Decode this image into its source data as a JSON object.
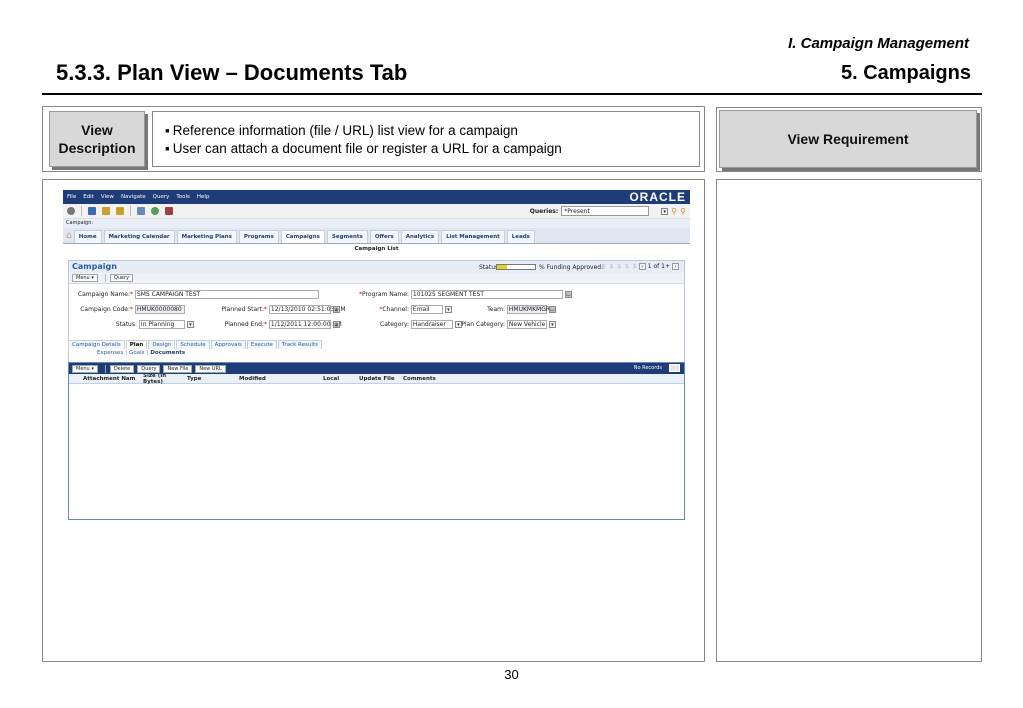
{
  "header": {
    "section": "I. Campaign Management",
    "title": "5.3.3. Plan View – Documents Tab",
    "chapter": "5. Campaigns"
  },
  "description": {
    "label_line1": "View",
    "label_line2": "Description",
    "bullets": [
      "Reference information (file / URL) list view for a campaign",
      "User can attach a document file or register a URL for a campaign"
    ]
  },
  "requirement": {
    "label": "View Requirement"
  },
  "page_number": "30",
  "app": {
    "menu": [
      "File",
      "Edit",
      "View",
      "Navigate",
      "Query",
      "Tools",
      "Help"
    ],
    "logo": "ORACLE",
    "queries_label": "Queries:",
    "queries_value": "*Present",
    "campaign_label": "Campaign:",
    "tabs": [
      "Home",
      "Marketing Calendar",
      "Marketing Plans",
      "Programs",
      "Campaigns",
      "Segments",
      "Offers",
      "Analytics",
      "List Management",
      "Leads"
    ],
    "active_tab": "Campaigns",
    "subtitle": "Campaign List",
    "applet": {
      "title": "Campaign",
      "status_label": "Status:",
      "status_progress": 0.25,
      "funding_label": "% Funding Approved:",
      "funding_dots": "$ $ $ $ $",
      "record_nav": "1 of 1+",
      "menu_btn": "Menu ▾",
      "query_btn": "Query"
    },
    "fields": {
      "campaign_name_label": "Campaign Name:",
      "campaign_name": "SMS CAMPAIGN TEST",
      "program_name_label": "Program Name:",
      "program_name": "101025 SEGMENT TEST",
      "campaign_code_label": "Campaign Code:",
      "campaign_code": "HMUK0000080",
      "planned_start_label": "Planned Start:",
      "planned_start": "12/13/2010 02:51:03 AM",
      "channel_label": "Channel:",
      "channel": "Email",
      "team_label": "Team:",
      "team": "HMUKMKMGR1",
      "status_label": "Status:",
      "status": "In Planning",
      "planned_end_label": "Planned End:",
      "planned_end": "1/12/2011 12:00:00 AM",
      "category_label": "Category:",
      "category": "Handraiser",
      "plan_category_label": "Plan Category:",
      "plan_category": "New Vehicle"
    },
    "subtabs": [
      "Campaign Details",
      "Plan",
      "Design",
      "Schedule",
      "Approvals",
      "Execute",
      "Track Results"
    ],
    "subsub": {
      "expenses": "Expenses",
      "goals": "Goals",
      "documents": "Documents"
    },
    "list": {
      "buttons": {
        "menu": "Menu ▾",
        "delete": "Delete",
        "query": "Query",
        "new_file": "New File",
        "new_url": "New URL"
      },
      "no_records": "No Records",
      "columns": [
        "Attachment Nam",
        "Size (In Bytes)",
        "Type",
        "Modified",
        "Local",
        "Update File",
        "Comments"
      ]
    }
  }
}
